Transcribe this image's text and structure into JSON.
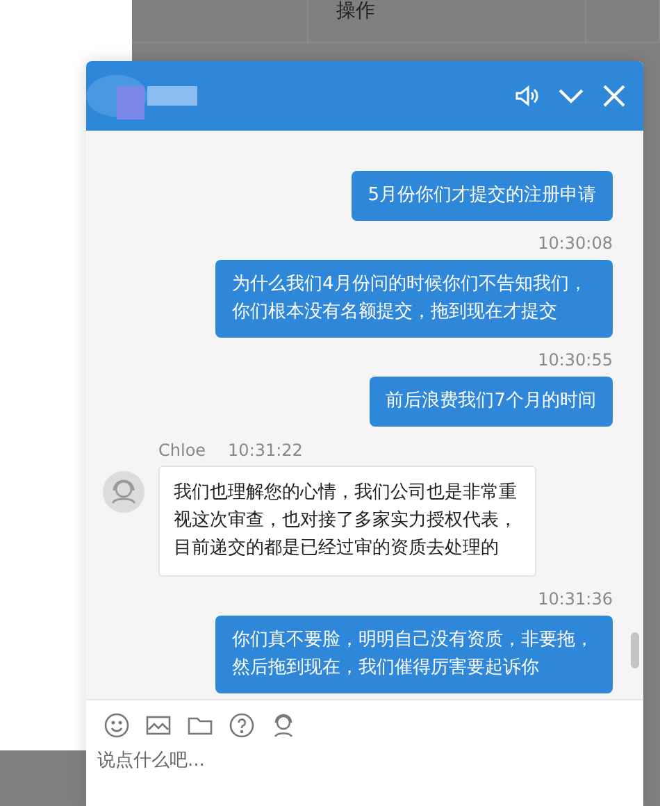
{
  "background": {
    "table_header": "操作"
  },
  "chat": {
    "messages": [
      {
        "kind": "sent",
        "text": "5月份你们才提交的注册申请"
      },
      {
        "kind": "sent",
        "time": "10:30:08",
        "text": "为什么我们4月份问的时候你们不告知我们，你们根本没有名额提交，拖到现在才提交"
      },
      {
        "kind": "sent",
        "time": "10:30:55",
        "text": "前后浪费我们7个月的时间"
      },
      {
        "kind": "received",
        "sender": "Chloe",
        "time": "10:31:22",
        "text": "我们也理解您的心情，我们公司也是非常重视这次审查，也对接了多家实力授权代表，目前递交的都是已经过审的资质去处理的"
      },
      {
        "kind": "sent",
        "time": "10:31:36",
        "text": "你们真不要脸，明明自己没有资质，非要拖，然后拖到现在，我们催得厉害要起诉你"
      }
    ],
    "input": {
      "placeholder": "说点什么吧..."
    }
  }
}
